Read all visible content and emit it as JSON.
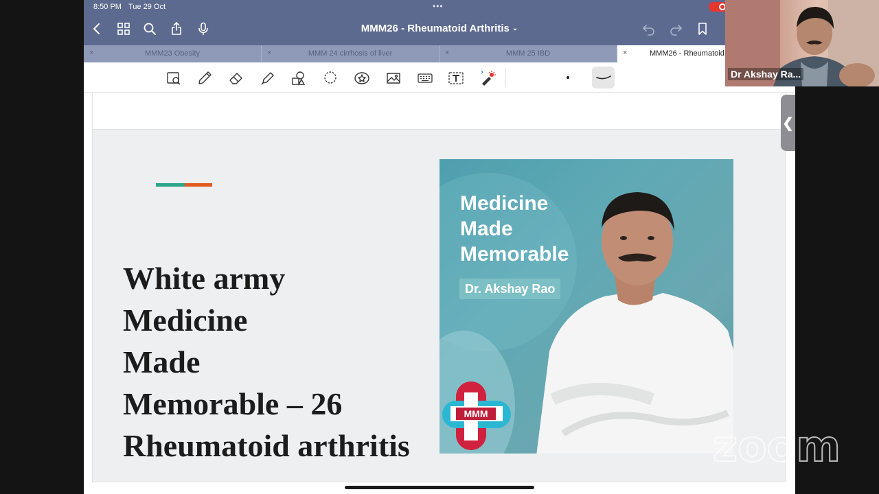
{
  "status_bar": {
    "time": "8:50 PM",
    "date": "Tue 29 Oct",
    "multitask": "•••"
  },
  "document": {
    "title": "MMM26 - Rheumatoid Arthritis",
    "title_chevron": "⌄"
  },
  "nav_icons": [
    "back-chevron-icon",
    "grid-icon",
    "search-icon",
    "share-icon",
    "microphone-icon",
    "undo-icon",
    "redo-icon",
    "bookmark-icon"
  ],
  "tabs": [
    {
      "label": "MMM23 Obesity",
      "close": "×",
      "active": false
    },
    {
      "label": "MMM 24 cirrhosis of liver",
      "close": "×",
      "active": false
    },
    {
      "label": "MMM 25 IBD",
      "close": "×",
      "active": false
    },
    {
      "label": "MMM26 - Rheumatoid Arthritis",
      "close": "×",
      "active": true
    }
  ],
  "toolbar_icons": [
    "zoom-lasso-icon",
    "pen-icon",
    "eraser-icon",
    "highlighter-icon",
    "shapes-icon",
    "lasso-icon",
    "sticker-icon",
    "image-icon",
    "keyboard-icon",
    "text-box-icon",
    "laser-pointer-icon"
  ],
  "colors": {
    "header": "#5c6a90",
    "tab_bar": "#8e9ab8",
    "accent_teal": "#2aa58a",
    "accent_orange": "#e35a21",
    "cover_bg": "#5fa9b5",
    "logo_red": "#d0213f",
    "logo_cyan": "#2bb7d2",
    "recording": "#e5362f"
  },
  "slide": {
    "title_lines": [
      "White army",
      "Medicine",
      "Made",
      "Memorable – 26",
      "Rheumatoid arthritis"
    ]
  },
  "cover": {
    "heading_lines": [
      "Medicine",
      "Made",
      "Memorable"
    ],
    "author": "Dr. Akshay Rao",
    "logo_text": "MMM"
  },
  "side_handle": {
    "glyph": "❮"
  },
  "video": {
    "participant_name": "Dr Akshay Ra..."
  },
  "zoom": {
    "watermark": "zoom"
  }
}
